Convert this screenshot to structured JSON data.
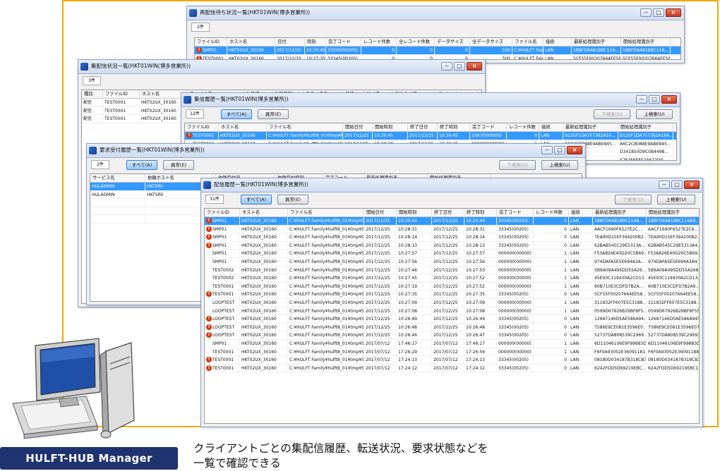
{
  "badge": "HULFT-HUB Manager",
  "caption": [
    "クライアントごとの集配信履歴、転送状況、要求状態などを",
    "一覧で確認できる"
  ],
  "icons": [
    "app-icon",
    "minimize-icon",
    "maximize-icon",
    "close-icon",
    "error-icon"
  ],
  "colors": {
    "frame": "#f0a900",
    "badge": "#1e3370",
    "selection": "#3399ff",
    "error": "#d23a10"
  },
  "win_buttons": {
    "minimize": "－",
    "maximize": "□",
    "close": "×"
  },
  "w1": {
    "title": "再配信待ち状況一覧(HKT01WIN(博多営業所))",
    "count": "2件",
    "headers": [
      "ファイルID",
      "ホスト名",
      "日付",
      "時刻",
      "完了コード",
      "レコード件数",
      "全レコード件数",
      "データサイズ",
      "全データサイズ",
      "ファイル名",
      "接続",
      "最新処理識別子",
      "開始処理識別子"
    ],
    "rows": [
      [
        "SMP01",
        "HKT02UX_30160",
        "2017/12/25",
        "10:20:45",
        "33345(00205)",
        "0",
        "0",
        "0",
        "500",
        "C:¥HULFT Fam...",
        "LAN",
        "1BBFD6A818BC11A...",
        "1BBFD6A818BC11A..."
      ],
      [
        "TEST0001",
        "HKT02UX_30160",
        "2017/12/25",
        "10:27:35",
        "33345(00205)",
        "0",
        "0",
        "0",
        "500",
        "C:¥HULFT Fam...",
        "LAN",
        "5CF55F00207664EE58...",
        "5CF55F00207664EE58..."
      ]
    ]
  },
  "w2": {
    "title": "集配信状況一覧(HKT01WIN(博多営業所))",
    "count": "3件",
    "headers": [
      "種別",
      "ファイルID",
      "ホスト名",
      "ファイル名",
      "依頼日",
      "依頼時刻",
      "ステータス",
      "接続",
      "サイズ",
      "全体サイズ",
      "パーセント"
    ],
    "rows": [
      [
        "配信",
        "TEST0001",
        "HKT02UX_30160"
      ],
      [
        "配信",
        "TEST0001",
        "HKT02UX_30160"
      ],
      [
        "配信",
        "TEST0001",
        "HKT02UX_30160"
      ]
    ]
  },
  "w3": {
    "title": "集信履歴一覧(HKT01WIN(博多営業所))",
    "count": "12件",
    "btn_all": "すべて(A)",
    "btn_detail": "異常(E)",
    "btn_down": "下検索(D)",
    "btn_up": "上検索(U)",
    "headers": [
      "ファイルID",
      "ホスト名",
      "ファイル名",
      "開始日付",
      "開始時刻",
      "終了日付",
      "終了時刻",
      "完了コード",
      "レコード件数",
      "接続",
      "最新処理識別子",
      "開始処理識別子"
    ],
    "rows": [
      [
        "TEST0003",
        "HKT02UX_30160",
        "C:¥HULFT Family¥hulft8_01¥tmp¥Rc...",
        "2017/12/25",
        "10:30:45",
        "2017/12/25",
        "10:30:45",
        "10970(00000)",
        "0",
        "LAN",
        "B120F1DA757382A16...",
        "B120F1DA757382A16A..."
      ],
      [
        "TEST0003",
        "HKT02UX_30160",
        "C:¥HULFT Family¥hulft8_01¥tmp¥Rc...",
        "2017/12/25",
        "10:30:28",
        "2017/12/25",
        "10:30:29",
        "000000(00000)",
        "1",
        "LAN",
        "A6C2CB088E9ABE845...",
        "A6C2CB088E9ABE845..."
      ]
    ],
    "side": [
      "D341850D9C0B4498...",
      "5762F6EF524672D9...",
      "6EC07846FF8390...",
      "DB6E5C07846FF8390..."
    ]
  },
  "w4": {
    "title": "要求受付履歴一覧(HKT01WIN(博多営業所))",
    "count": "2件",
    "btn_all": "すべて(A)",
    "btn_detail": "異常(E)",
    "btn_down": "下検索(D)",
    "btn_up": "上検索(U)",
    "headers": [
      "サービス名",
      "依頼ホスト名",
      "依頼受付日",
      "依頼受付時刻",
      "完了コード",
      "最新処理識別子",
      "開始処理識別子"
    ],
    "rows": [
      [
        "HULADMIN",
        "HKTSRV"
      ],
      [
        "HULADMIN",
        "HKTSRV"
      ]
    ],
    "side": [
      "D0B341850D9C0B498...",
      "36F5762F6EF524672D...",
      "DB6E5C07846FF8390..."
    ]
  },
  "w5": {
    "title": "配信履歴一覧(HKT01WIN(博多営業所))",
    "count": "31件",
    "btn_all": "すべて(A)",
    "btn_detail": "異常(E)",
    "btn_down": "下検索(D)",
    "btn_up": "上検索(U)",
    "headers": [
      "ファイルID",
      "ホスト名",
      "ファイル名",
      "開始日付",
      "開始時刻",
      "終了日付",
      "終了時刻",
      "完了コード",
      "レコード件数",
      "接続",
      "最新処理識別子",
      "開始処理識別子"
    ],
    "rows": [
      [
        "SMP01",
        "HKT02UX_30160",
        "C:¥HULFT Family¥hulft8_01¥tmp¥Se...",
        "2017/12/25",
        "10:20:44",
        "2017/12/25",
        "10:20:44",
        "33345(00205)",
        "0",
        "LAN",
        "1BBFD6A818BC11AB...",
        "1BBFD6A818BC11AB9..."
      ],
      [
        "SMP01",
        "HKT02UX_30160",
        "C:¥HULFT Family¥hulft8_01¥tmp¥Se...",
        "2017/12/25",
        "10:28:31",
        "2017/12/25",
        "10:28:31",
        "33345(00205)",
        "0",
        "LAN",
        "AACF1690F6527E2C...",
        "AACF1690F6527E2C6..."
      ],
      [
        "SMP01",
        "HKT02UX_30160",
        "C:¥HULFT Family¥hulft8_01¥tmp¥Se...",
        "2017/12/25",
        "10:28:14",
        "2017/12/25",
        "10:28:14",
        "33345(00205)",
        "0",
        "LAN",
        "7EA90D15EF394200B2...",
        "7EA90D15EF394200B2..."
      ],
      [
        "SMP01",
        "HKT02UX_30160",
        "C:¥HULFT Family¥hulft8_01¥tmp¥Se...",
        "2017/12/25",
        "10:28:13",
        "2017/12/25",
        "10:28:13",
        "33345(00205)",
        "0",
        "LAN",
        "62BAB545C29E5313A...",
        "62BAB545C29E5313A4..."
      ],
      [
        "SMP01",
        "HKT02UX_30160",
        "C:¥HULFT Family¥hulft8_01¥tmp¥Se...",
        "2017/12/25",
        "10:27:57",
        "2017/12/25",
        "10:27:57",
        "000000(00000)",
        "1",
        "LAN",
        "F53A826E40D20C5B69...",
        "F53A826E40D20C5B69..."
      ],
      [
        "SMP01",
        "HKT02UX_30160",
        "C:¥HULFT Family¥hulft8_01¥tmp¥Se...",
        "2017/12/25",
        "10:27:56",
        "2017/12/25",
        "10:27:56",
        "000000(00000)",
        "1",
        "LAN",
        "974DAFA5E5E694A3A...",
        "974DAFA5E5E694A3A4..."
      ],
      [
        "TEST0002",
        "HKT02UX_30160",
        "C:¥HULFT Family¥hulft8_01¥tmp¥Se...",
        "2017/12/25",
        "10:27:46",
        "2017/12/25",
        "10:27:53",
        "000000(00000)",
        "1",
        "LAN",
        "5B9A09A495DD55A26...",
        "5B9A09A495DD55A268..."
      ],
      [
        "TEST0002",
        "HKT02UX_30160",
        "C:¥HULFT Family¥hulft8_01¥tmp¥Se...",
        "2017/12/25",
        "10:27:45",
        "2017/12/25",
        "10:27:52",
        "000000(00000)",
        "1",
        "LAN",
        "45E93C119430A2CD13...",
        "45E93C119430A2CD13..."
      ],
      [
        "TEST0001",
        "HKT02UX_30160",
        "C:¥HULFT Family¥hulft8_01¥tmp¥Se...",
        "2017/12/25",
        "10:27:19",
        "2017/12/25",
        "10:27:52",
        "000000(00000)",
        "1",
        "LAN",
        "60B710E3CDFD7B2A...",
        "60B710E3CDFD7B2A9..."
      ],
      [
        "TEST0001",
        "HKT02UX_30160",
        "C:¥HULFT Family¥hulft8_01¥tmp¥Se...",
        "2017/12/25",
        "10:27:35",
        "2017/12/25",
        "10:27:35",
        "33345(00205)",
        "0",
        "LAN",
        "5CF55F00207664EE58...",
        "5CF55F00207664EE58..."
      ],
      [
        "LOOPTEST",
        "HKT02UX_30160",
        "C:¥HULFT Family¥hulft8_01¥tmp¥Se...",
        "2017/12/25",
        "10:27:09",
        "2017/12/25",
        "10:27:09",
        "000000(00000)",
        "1",
        "LAN",
        "311832FF607E5C3188...",
        "311832FF607E5C3188..."
      ],
      [
        "LOOPTEST",
        "HKT02UX_30160",
        "C:¥HULFT Family¥hulft8_01¥tmp¥Se...",
        "2017/12/25",
        "10:27:08",
        "2017/12/25",
        "10:27:08",
        "000000(00000)",
        "1",
        "LAN",
        "0599D67926B29BF8F5...",
        "0599D67926B29BF8F55..."
      ],
      [
        "LOOPTEST",
        "HKT02UX_30160",
        "C:¥HULFT Family¥hulft8_01¥tmp¥Se...",
        "2017/12/25",
        "10:26:49",
        "2017/12/25",
        "10:26:49",
        "33345(00205)",
        "0",
        "LAN",
        "12687146D5AE586A94...",
        "12687146D5AE586A945..."
      ],
      [
        "LOOPTEST",
        "HKT02UX_30160",
        "C:¥HULFT Family¥hulft8_01¥tmp¥Se...",
        "2017/12/25",
        "10:26:48",
        "2017/12/25",
        "10:26:48",
        "33345(00205)",
        "0",
        "LAN",
        "7586E9CE081E3596E0...",
        "7586E9CE081E3596E07..."
      ],
      [
        "LOOPTEST",
        "HKT02UX_30160",
        "C:¥HULFT Family¥hulft8_01¥tmp¥Se...",
        "2017/12/25",
        "10:26:46",
        "2017/12/25",
        "10:26:47",
        "33345(00205)",
        "0",
        "LAN",
        "52737DA808539C2969...",
        "52737DA808539C29693..."
      ],
      [
        "SMP01",
        "HKT02UX_30160",
        "C:¥HULFT Family¥hulft8_01¥tmp¥Se...",
        "2017/07/12",
        "17:46:17",
        "2017/07/12",
        "17:46:17",
        "000000(00000)",
        "1",
        "LAN",
        "6D11046106E9F99883D...",
        "6D11046106E9F99883D..."
      ],
      [
        "TEST0001",
        "HKT02UX_30160",
        "C:¥HULFT Family¥hulft8_01¥tmp¥Se...",
        "2017/07/12",
        "17:26:29",
        "2017/07/12",
        "17:26:56",
        "000000(00000)",
        "1",
        "LAN",
        "F6F0A93052E36091181...",
        "F6F0A93052E36091188..."
      ],
      [
        "TEST0001",
        "HKT02UX_30160",
        "C:¥HULFT Family¥hulft8_01¥tmp¥Se...",
        "2017/07/12",
        "17:24:13",
        "2017/07/12",
        "17:24:13",
        "33345(00205)",
        "0",
        "LAN",
        "08180D034187B318CB3...",
        "08180D034187B318CB3..."
      ],
      [
        "TEST0001",
        "HKT02UX_30160",
        "C:¥HULFT Family¥hulft8_01¥tmp¥Se...",
        "2017/07/12",
        "17:24:12",
        "2017/07/12",
        "17:24:12",
        "33345(00205)",
        "0",
        "LAN",
        "6242FDD5D69219EBC...",
        "6242FDD5D69219EBC1..."
      ]
    ]
  }
}
